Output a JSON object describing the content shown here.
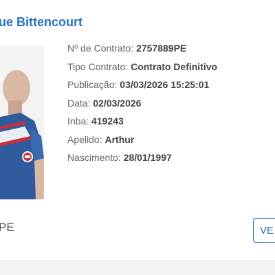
{
  "player": {
    "name": "ue Bittencourt",
    "photo_icon": "player-photo"
  },
  "details": [
    {
      "label": "Nº de Contrato:",
      "value": "2757889PE"
    },
    {
      "label": "Tipo Contrato:",
      "value": "Contrato Definitivo"
    },
    {
      "label": "Publicação:",
      "value": "03/03/2026 15:25:01"
    },
    {
      "label": "Data:",
      "value": "02/03/2026"
    },
    {
      "label": "Inba:",
      "value": "419243"
    },
    {
      "label": "Apelido:",
      "value": "Arthur"
    },
    {
      "label": "Nascimento:",
      "value": "28/01/1997"
    }
  ],
  "state": "PE",
  "actions": {
    "view_label": "VE"
  },
  "colors": {
    "accent": "#2a70c6",
    "label_text": "#666666",
    "value_text": "#444444",
    "footer_band": "#f3f3f3"
  }
}
